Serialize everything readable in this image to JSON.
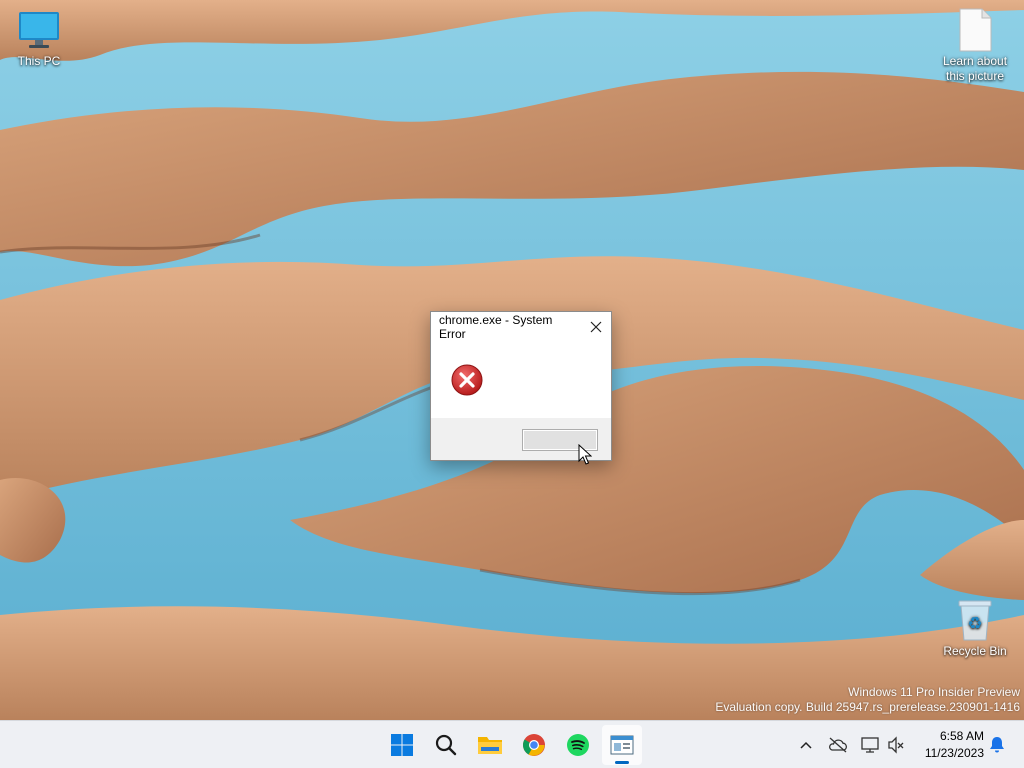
{
  "desktop": {
    "icons": [
      {
        "label": "This PC",
        "icon": "monitor-icon"
      },
      {
        "label": "Learn about this picture",
        "icon": "document-icon"
      },
      {
        "label": "Recycle Bin",
        "icon": "recycle-bin-icon"
      }
    ],
    "watermark": {
      "line1": "Windows 11 Pro Insider Preview",
      "line2": "Evaluation copy. Build 25947.rs_prerelease.230901-1416"
    }
  },
  "dialog": {
    "title": "chrome.exe - System Error",
    "close_label": "✕",
    "icon": "error-x-icon",
    "message": "",
    "ok_button_label": ""
  },
  "taskbar": {
    "pinned": [
      {
        "name": "start",
        "icon": "windows-logo-icon",
        "active": false
      },
      {
        "name": "search",
        "icon": "search-icon",
        "active": false
      },
      {
        "name": "file-explorer",
        "icon": "folder-icon",
        "active": false
      },
      {
        "name": "chrome",
        "icon": "chrome-icon",
        "active": false
      },
      {
        "name": "spotify",
        "icon": "spotify-icon",
        "active": false
      },
      {
        "name": "error-window",
        "icon": "window-app-icon",
        "active": true
      }
    ],
    "tray": {
      "icons": [
        "chevron-up-icon",
        "onedrive-offline-icon",
        "network-icon",
        "volume-muted-icon",
        "notification-bell-icon"
      ],
      "time": "6:58 AM",
      "date": "11/23/2023"
    }
  },
  "colors": {
    "taskbar_bg": "#eef0f4",
    "accent": "#0067c0",
    "error_red": "#d32f2f",
    "water": "#6ab7d2",
    "sand": "#c9916a"
  }
}
